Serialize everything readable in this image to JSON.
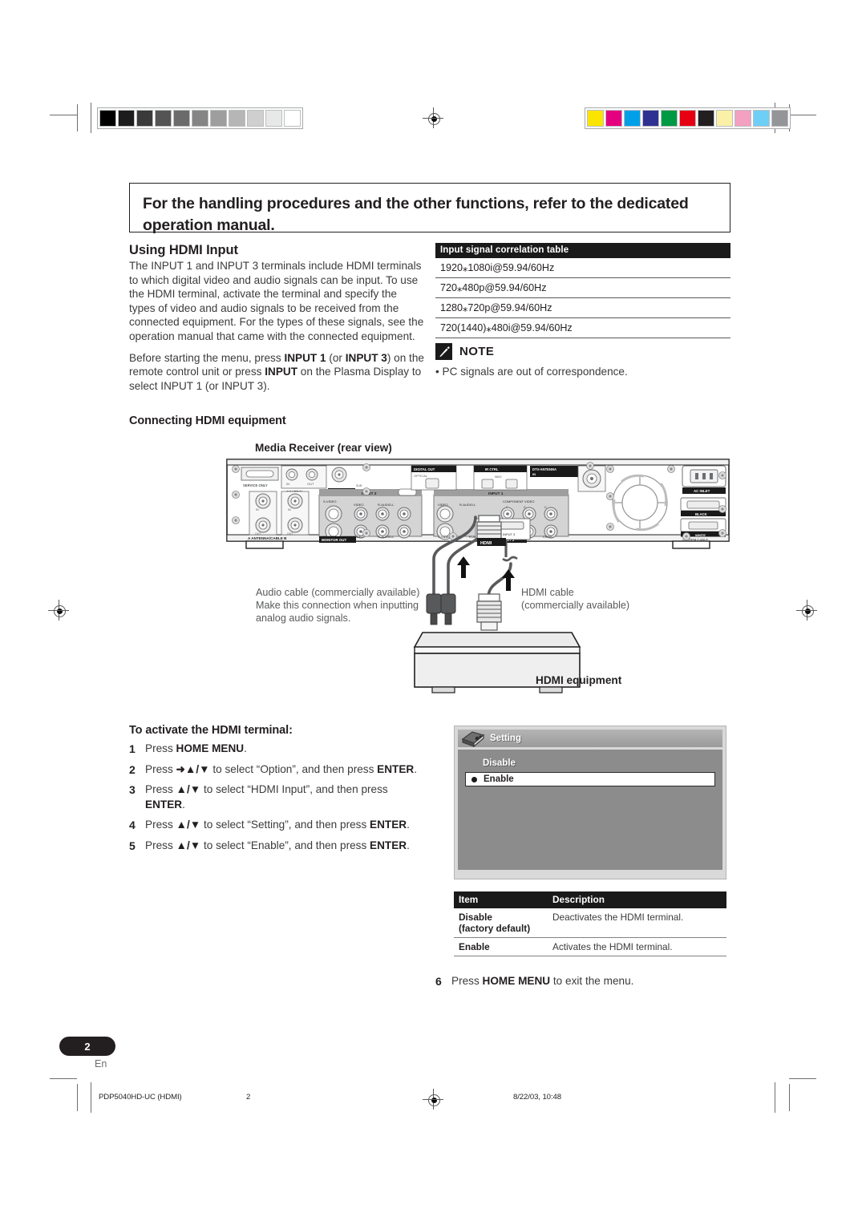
{
  "callout": {
    "text": "For the handling procedures and the other functions, refer to the dedicated operation manual."
  },
  "section": {
    "title": "Using HDMI Input",
    "para1": "The INPUT 1 and INPUT 3 terminals include HDMI terminals to which digital video and audio signals can be input. To use the HDMI terminal, activate the terminal and specify the types of video and audio signals to be received from the connected equipment. For the types of these signals, see the operation manual that came with the connected equipment."
  },
  "signal_table": {
    "header": "Input signal correlation table",
    "rows": [
      "1920⁎1080i@59.94/60Hz",
      "720⁎480p@59.94/60Hz",
      "1280⁎720p@59.94/60Hz",
      "720(1440)⁎480i@59.94/60Hz"
    ]
  },
  "note": {
    "icon": "pencil-icon",
    "title": "NOTE",
    "items": [
      "PC signals are out of correspondence."
    ]
  },
  "connecting": {
    "heading": "Connecting HDMI equipment",
    "receiver_label": "Media Receiver (rear view)",
    "audio_cable_label": "Audio cable (commercially available)\nMake this connection when inputting\nanalog audio signals.",
    "hdmi_cable_label": "HDMI cable\n(commercially available)",
    "equipment_label": "HDMI equipment"
  },
  "activate": {
    "heading": "To activate the HDMI terminal:",
    "steps": [
      {
        "n": "1",
        "text": "Press HOME MENU."
      },
      {
        "n": "2",
        "text": "Press ↑/↓ to select “Option”, and then press ENTER."
      },
      {
        "n": "3",
        "text": "Press ↑/↓ to select “HDMI Input”, and then press ENTER."
      },
      {
        "n": "4",
        "text": "Press ↑/↓ to select “Setting”, and then press ENTER."
      },
      {
        "n": "5",
        "text": "Press ↑/↓ to select “Enable”, and then press ENTER."
      }
    ],
    "step6": {
      "n": "6",
      "text": "Press HOME MENU to exit the menu."
    }
  },
  "osd": {
    "title": "Setting",
    "icon": "setting-icon",
    "option_disable": "Disable",
    "option_enable": "Enable"
  },
  "item_table": {
    "headers": [
      "Item",
      "Description"
    ],
    "rows": [
      {
        "item": "Disable\n(factory default)",
        "description": "Deactivates the HDMI terminal."
      },
      {
        "item": "Enable",
        "description": "Activates the HDMI terminal."
      }
    ]
  },
  "page": {
    "number": "2",
    "language": "En"
  },
  "footer": {
    "file": "PDP5040HD-UC (HDMI)",
    "page": "2",
    "date": "8/22/03, 10:48"
  },
  "colorbars": {
    "gray": [
      "#000000",
      "#1c1c1c",
      "#3a3a3a",
      "#545454",
      "#6b6b6b",
      "#858585",
      "#9e9e9e",
      "#b6b6b6",
      "#cfcfcf",
      "#e8e8e8",
      "#ffffff"
    ],
    "color": [
      "#fbe400",
      "#e5007f",
      "#00a0e9",
      "#2e3192",
      "#009944",
      "#e60012",
      "#231f20",
      "#fbf0a8",
      "#f4a0c0",
      "#6ecff6",
      "#939598"
    ]
  }
}
